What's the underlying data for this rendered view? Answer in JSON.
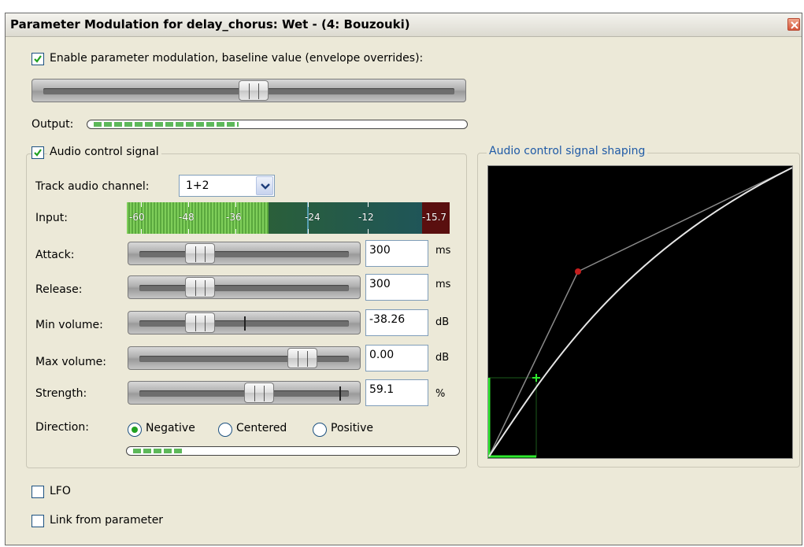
{
  "window": {
    "title": "Parameter Modulation for delay_chorus: Wet - (4: Bouzouki)"
  },
  "enable": {
    "label": "Enable parameter modulation, baseline value (envelope overrides):",
    "checked": true,
    "baseline_fraction": 0.5
  },
  "output": {
    "label": "Output:",
    "level_fraction": 0.38
  },
  "audio_control": {
    "label": "Audio control signal",
    "checked": true,
    "track_channel": {
      "label": "Track audio channel:",
      "value": "1+2"
    },
    "input": {
      "label": "Input:",
      "ticks": [
        "-60",
        "-48",
        "-36",
        "-24",
        "-12",
        "-15.7"
      ]
    },
    "attack": {
      "label": "Attack:",
      "value": "300",
      "unit": "ms"
    },
    "release": {
      "label": "Release:",
      "value": "300",
      "unit": "ms"
    },
    "min_volume": {
      "label": "Min volume:",
      "value": "-38.26",
      "unit": "dB"
    },
    "max_volume": {
      "label": "Max volume:",
      "value": "0.00",
      "unit": "dB"
    },
    "strength": {
      "label": "Strength:",
      "value": "59.1",
      "unit": "%"
    },
    "direction": {
      "label": "Direction:",
      "options": [
        "Negative",
        "Centered",
        "Positive"
      ],
      "selected": "Negative"
    },
    "direction_level_fraction": 0.2
  },
  "shaping": {
    "label": "Audio control signal shaping"
  },
  "lfo": {
    "label": "LFO",
    "checked": false
  },
  "link": {
    "label": "Link from parameter",
    "checked": false
  },
  "colors": {
    "accent": "#1f5aa6",
    "check": "#21a121",
    "meter_green": "#5db85a"
  }
}
